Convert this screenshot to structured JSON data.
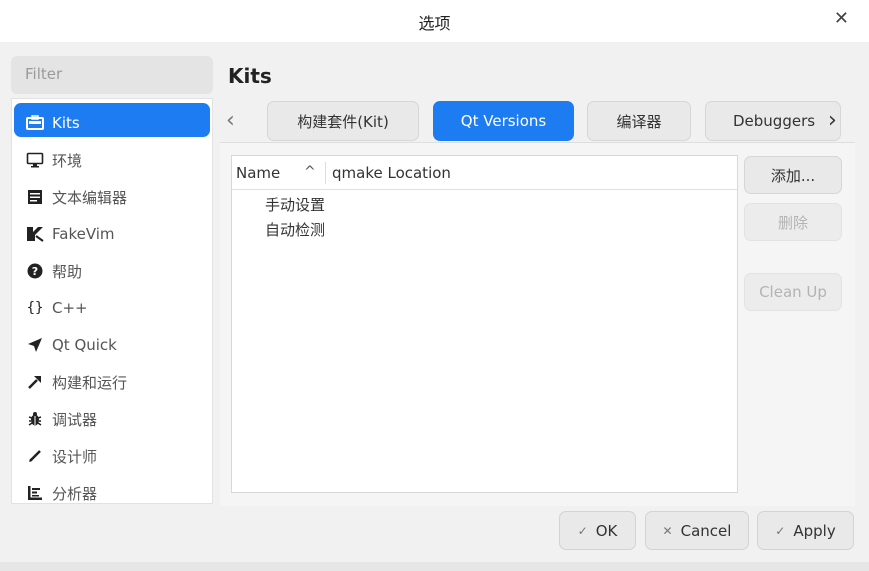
{
  "dialog": {
    "title": "选项",
    "close_icon": "close-icon"
  },
  "filter": {
    "placeholder": "Filter"
  },
  "sidebar": {
    "items": [
      {
        "label": "Kits",
        "icon": "kits-icon",
        "active": true
      },
      {
        "label": "环境",
        "icon": "monitor-icon",
        "active": false
      },
      {
        "label": "文本编辑器",
        "icon": "text-editor-icon",
        "active": false
      },
      {
        "label": "FakeVim",
        "icon": "fakevim-icon",
        "active": false
      },
      {
        "label": "帮助",
        "icon": "help-icon",
        "active": false
      },
      {
        "label": "C++",
        "icon": "braces-icon",
        "active": false
      },
      {
        "label": "Qt Quick",
        "icon": "qt-quick-icon",
        "active": false
      },
      {
        "label": "构建和运行",
        "icon": "hammer-icon",
        "active": false
      },
      {
        "label": "调试器",
        "icon": "bug-icon",
        "active": false
      },
      {
        "label": "设计师",
        "icon": "pencil-icon",
        "active": false
      },
      {
        "label": "分析器",
        "icon": "analyzer-icon",
        "active": false
      }
    ]
  },
  "main": {
    "title": "Kits",
    "tabs": [
      {
        "label": "构建套件(Kit)",
        "active": false
      },
      {
        "label": "Qt Versions",
        "active": true
      },
      {
        "label": "编译器",
        "active": false
      },
      {
        "label": "Debuggers",
        "active": false
      }
    ],
    "tree": {
      "columns": [
        "Name",
        "qmake Location"
      ],
      "rows": [
        "手动设置",
        "自动检测"
      ]
    },
    "buttons": {
      "add": "添加...",
      "remove": "删除",
      "cleanup": "Clean Up"
    }
  },
  "footer": {
    "ok": "OK",
    "cancel": "Cancel",
    "apply": "Apply"
  },
  "colors": {
    "accent": "#1d7cf2"
  }
}
